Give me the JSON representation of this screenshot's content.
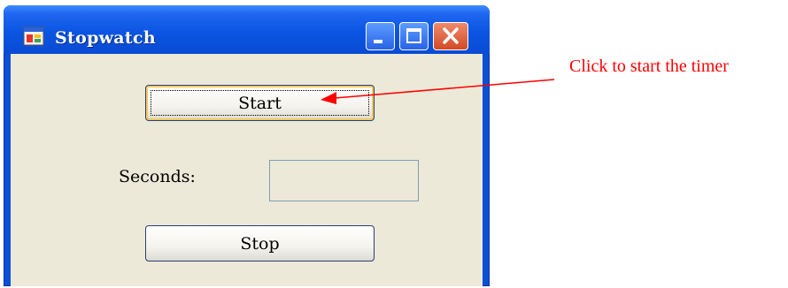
{
  "window": {
    "title": "Stopwatch",
    "controls": {
      "minimize_icon": "minimize-icon",
      "maximize_icon": "maximize-icon",
      "close_icon": "close-icon"
    }
  },
  "form": {
    "start_label": "Start",
    "seconds_label": "Seconds:",
    "seconds_value": "",
    "stop_label": "Stop"
  },
  "annotation": {
    "text": "Click to start the timer",
    "color": "#ff0000"
  },
  "colors": {
    "titlebar": "#0a55e3",
    "client_bg": "#ece9d8",
    "close_button": "#d24a25"
  }
}
